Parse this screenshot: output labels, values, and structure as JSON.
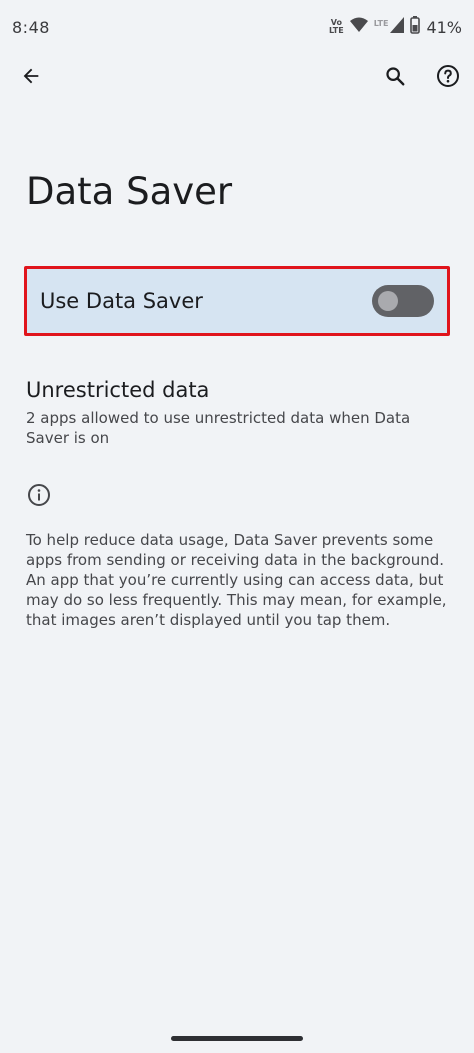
{
  "status_bar": {
    "time": "8:48",
    "volte_line1": "Vo",
    "volte_line2": "LTE",
    "lte_label": "LTE",
    "battery_percent": "41%"
  },
  "top_bar": {
    "back_icon": "arrow-back-icon",
    "search_icon": "search-icon",
    "help_icon": "help-icon"
  },
  "page": {
    "title": "Data Saver"
  },
  "toggle": {
    "label": "Use Data Saver",
    "state": "off",
    "highlight_color": "#e0141c"
  },
  "unrestricted": {
    "title": "Unrestricted data",
    "summary": "2 apps allowed to use unrestricted data when Data Saver is on"
  },
  "footer": {
    "info_icon": "info-icon",
    "text": "To help reduce data usage, Data Saver prevents some apps from sending or receiving data in the background. An app that you’re currently using can access data, but may do so less frequently. This may mean, for example, that images aren’t displayed until you tap them."
  }
}
